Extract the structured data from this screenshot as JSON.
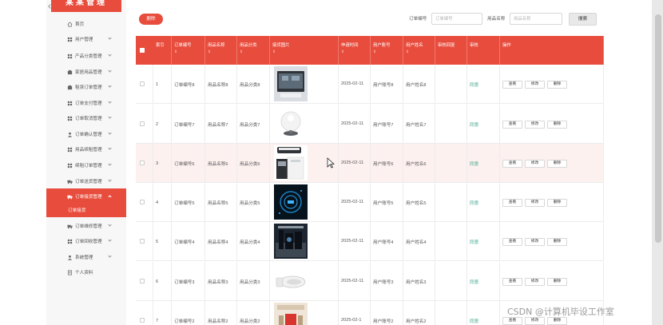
{
  "app": {
    "logo_text": "某某管理"
  },
  "sidebar": {
    "items": [
      {
        "label": "首页",
        "icon": "home-icon"
      },
      {
        "label": "用户管理",
        "icon": "grid-icon"
      },
      {
        "label": "产品分类管理",
        "icon": "grid-icon"
      },
      {
        "label": "家居用品管理",
        "icon": "box-icon"
      },
      {
        "label": "租赁订单管理",
        "icon": "box-icon"
      },
      {
        "label": "订单支付管理",
        "icon": "grid-icon"
      },
      {
        "label": "订单取消管理",
        "icon": "grid-icon"
      },
      {
        "label": "订单确认管理",
        "icon": "user-icon"
      },
      {
        "label": "用品续租管理",
        "icon": "grid-icon"
      },
      {
        "label": "续租订单管理",
        "icon": "grid-icon"
      },
      {
        "label": "订单送货管理",
        "icon": "truck-icon"
      },
      {
        "label": "订单接货管理",
        "icon": "truck-icon"
      },
      {
        "label": "订单维修管理",
        "icon": "truck-icon"
      },
      {
        "label": "订单回收管理",
        "icon": "grid-icon"
      },
      {
        "label": "系统管理",
        "icon": "user-icon"
      },
      {
        "label": "个人资料",
        "icon": "doc-icon"
      }
    ],
    "active_sub": "订单接货"
  },
  "toolbar": {
    "delete_label": "删除",
    "order_no_label": "订单编号",
    "order_no_placeholder": "订单编号",
    "item_name_label": "用品名称",
    "item_name_placeholder": "用品名称",
    "search_label": "搜索"
  },
  "table": {
    "sort_mark": "⇕",
    "headers": [
      "索引",
      "订单编号",
      "用品名称",
      "用品分类",
      "接货图片",
      "申请时间",
      "用户账号",
      "用户姓名",
      "审核回复",
      "审核",
      "操作"
    ],
    "rows": [
      {
        "idx": "1",
        "order": "订单编号8",
        "name": "用品名称8",
        "cat": "用品分类8",
        "time": "2025-02-11",
        "account": "用户账号8",
        "uname": "用户姓名8",
        "audit": "同意"
      },
      {
        "idx": "2",
        "order": "订单编号7",
        "name": "用品名称7",
        "cat": "用品分类7",
        "time": "2025-02-11",
        "account": "用户账号7",
        "uname": "用户姓名7",
        "audit": "同意"
      },
      {
        "idx": "3",
        "order": "订单编号6",
        "name": "用品名称6",
        "cat": "用品分类6",
        "time": "2025-02-11",
        "account": "用户账号6",
        "uname": "用户姓名6",
        "audit": "同意"
      },
      {
        "idx": "4",
        "order": "订单编号5",
        "name": "用品名称5",
        "cat": "用品分类5",
        "time": "2025-02-11",
        "account": "用户账号5",
        "uname": "用户姓名5",
        "audit": "同意"
      },
      {
        "idx": "5",
        "order": "订单编号4",
        "name": "用品名称4",
        "cat": "用品分类4",
        "time": "2025-02-11",
        "account": "用户账号4",
        "uname": "用户姓名4",
        "audit": "同意"
      },
      {
        "idx": "6",
        "order": "订单编号3",
        "name": "用品名称3",
        "cat": "用品分类3",
        "time": "2025-02-11",
        "account": "用户账号3",
        "uname": "用户姓名3",
        "audit": "同意"
      },
      {
        "idx": "7",
        "order": "订单编号2",
        "name": "用品名称2",
        "cat": "用品分类2",
        "time": "2025-02-1",
        "account": "用户账号2",
        "uname": "用户姓名2",
        "audit": "同意"
      }
    ],
    "actions": [
      "查看",
      "修改",
      "删除"
    ]
  },
  "colors": {
    "accent": "#e84c3d",
    "audit_ok": "#3aa58a"
  },
  "watermark": "CSDN @计算机毕设工作室"
}
